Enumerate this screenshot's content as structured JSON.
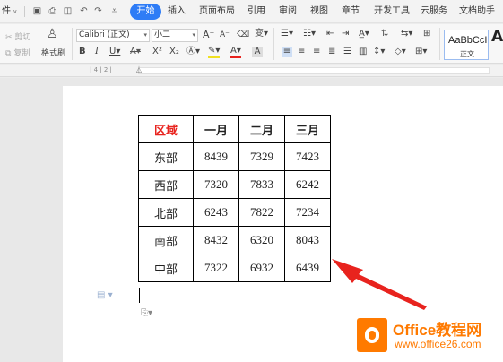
{
  "menubar": {
    "file_label": "件",
    "tabs": [
      {
        "label": "开始",
        "active": true
      },
      {
        "label": "插入"
      },
      {
        "label": "页面布局"
      },
      {
        "label": "引用"
      },
      {
        "label": "审阅"
      },
      {
        "label": "视图"
      },
      {
        "label": "章节"
      },
      {
        "label": "开发工具"
      },
      {
        "label": "云服务"
      },
      {
        "label": "文档助手"
      }
    ]
  },
  "ribbon": {
    "cut_label": "剪切",
    "copy_label": "复制",
    "format_painter_label": "格式刷",
    "font_name": "Calibri (正文)",
    "font_size": "小二",
    "style_sample": "AaBbCcI",
    "style_name": "正文",
    "style_next": "A"
  },
  "table": {
    "header": [
      "区域",
      "一月",
      "二月",
      "三月"
    ],
    "rows": [
      [
        "东部",
        "8439",
        "7329",
        "7423"
      ],
      [
        "西部",
        "7320",
        "7833",
        "6242"
      ],
      [
        "北部",
        "6243",
        "7822",
        "7234"
      ],
      [
        "南部",
        "8432",
        "6320",
        "8043"
      ],
      [
        "中部",
        "7322",
        "6932",
        "6439"
      ]
    ]
  },
  "watermark": {
    "brand": "Office教程网",
    "url": "www.office26.com"
  },
  "colors": {
    "accent": "#2e7cf6",
    "header_red": "#e8231e",
    "arrow_red": "#e8231e",
    "logo_orange": "#ff7a00"
  }
}
